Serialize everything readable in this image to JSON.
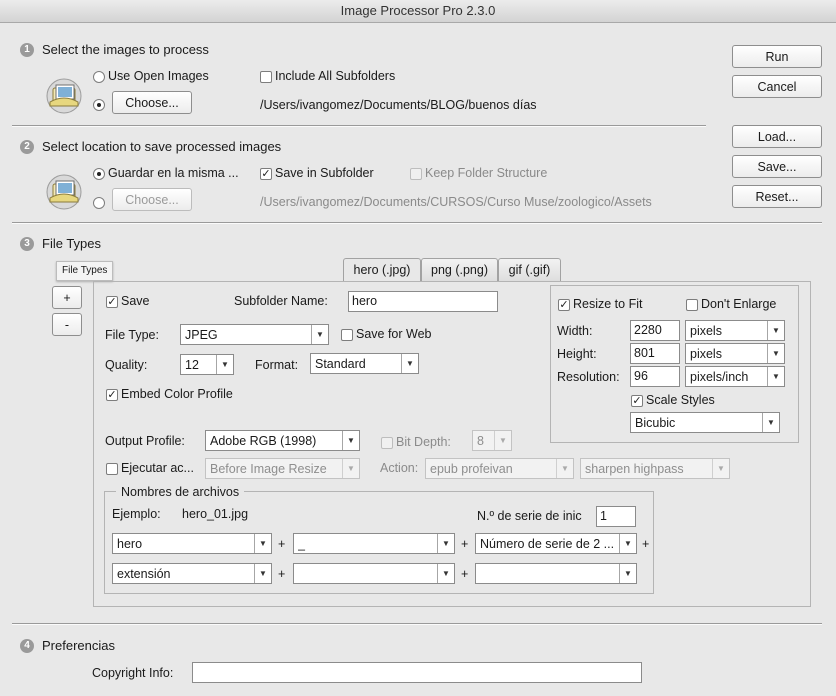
{
  "window": {
    "title": "Image Processor Pro 2.3.0"
  },
  "section1": {
    "num": "1",
    "title": "Select the images to process",
    "use_open_images": "Use Open Images",
    "include_subfolders": "Include All Subfolders",
    "choose": "Choose...",
    "path": "/Users/ivangomez/Documents/BLOG/buenos días"
  },
  "section2": {
    "num": "2",
    "title": "Select location to save processed images",
    "same_location": "Guardar en la misma ...",
    "save_in_subfolder": "Save in Subfolder",
    "keep_structure": "Keep Folder Structure",
    "choose": "Choose...",
    "path": "/Users/ivangomez/Documents/CURSOS/Curso Muse/zoologico/Assets"
  },
  "side_buttons": {
    "run": "Run",
    "cancel": "Cancel",
    "load": "Load...",
    "save": "Save...",
    "reset": "Reset..."
  },
  "section3": {
    "num": "3",
    "title": "File Types",
    "tooltip": "File Types",
    "add": "+",
    "remove": "-",
    "tabs": [
      "hero (.jpg)",
      "png (.png)",
      "gif (.gif)"
    ],
    "save_label": "Save",
    "subfolder_name_label": "Subfolder Name:",
    "subfolder_name": "hero",
    "file_type_label": "File Type:",
    "file_type": "JPEG",
    "save_for_web": "Save for Web",
    "quality_label": "Quality:",
    "quality": "12",
    "format_label": "Format:",
    "format": "Standard",
    "embed_profile": "Embed Color Profile",
    "resize_to_fit": "Resize to Fit",
    "dont_enlarge": "Don't Enlarge",
    "width_label": "Width:",
    "width": "2280",
    "width_unit": "pixels",
    "height_label": "Height:",
    "height": "801",
    "height_unit": "pixels",
    "resolution_label": "Resolution:",
    "resolution": "96",
    "resolution_unit": "pixels/inch",
    "scale_styles": "Scale Styles",
    "resample": "Bicubic",
    "output_profile_label": "Output Profile:",
    "output_profile": "Adobe RGB (1998)",
    "bit_depth_label": "Bit Depth:",
    "bit_depth": "8",
    "run_action": "Ejecutar ac...",
    "action_when": "Before Image Resize",
    "action_label": "Action:",
    "action_set": "epub profeivan",
    "action_name": "sharpen highpass",
    "naming": {
      "title": "Nombres de archivos",
      "example_label": "Ejemplo:",
      "example": "hero_01.jpg",
      "serial_label": "N.º de serie de inic",
      "serial": "1",
      "row1": [
        "hero",
        "_",
        "Número de serie de 2 ..."
      ],
      "row2": [
        "extensión",
        "",
        ""
      ],
      "plus": "+"
    }
  },
  "section4": {
    "num": "4",
    "title": "Preferencias",
    "copyright_label": "Copyright Info:",
    "copyright": ""
  }
}
